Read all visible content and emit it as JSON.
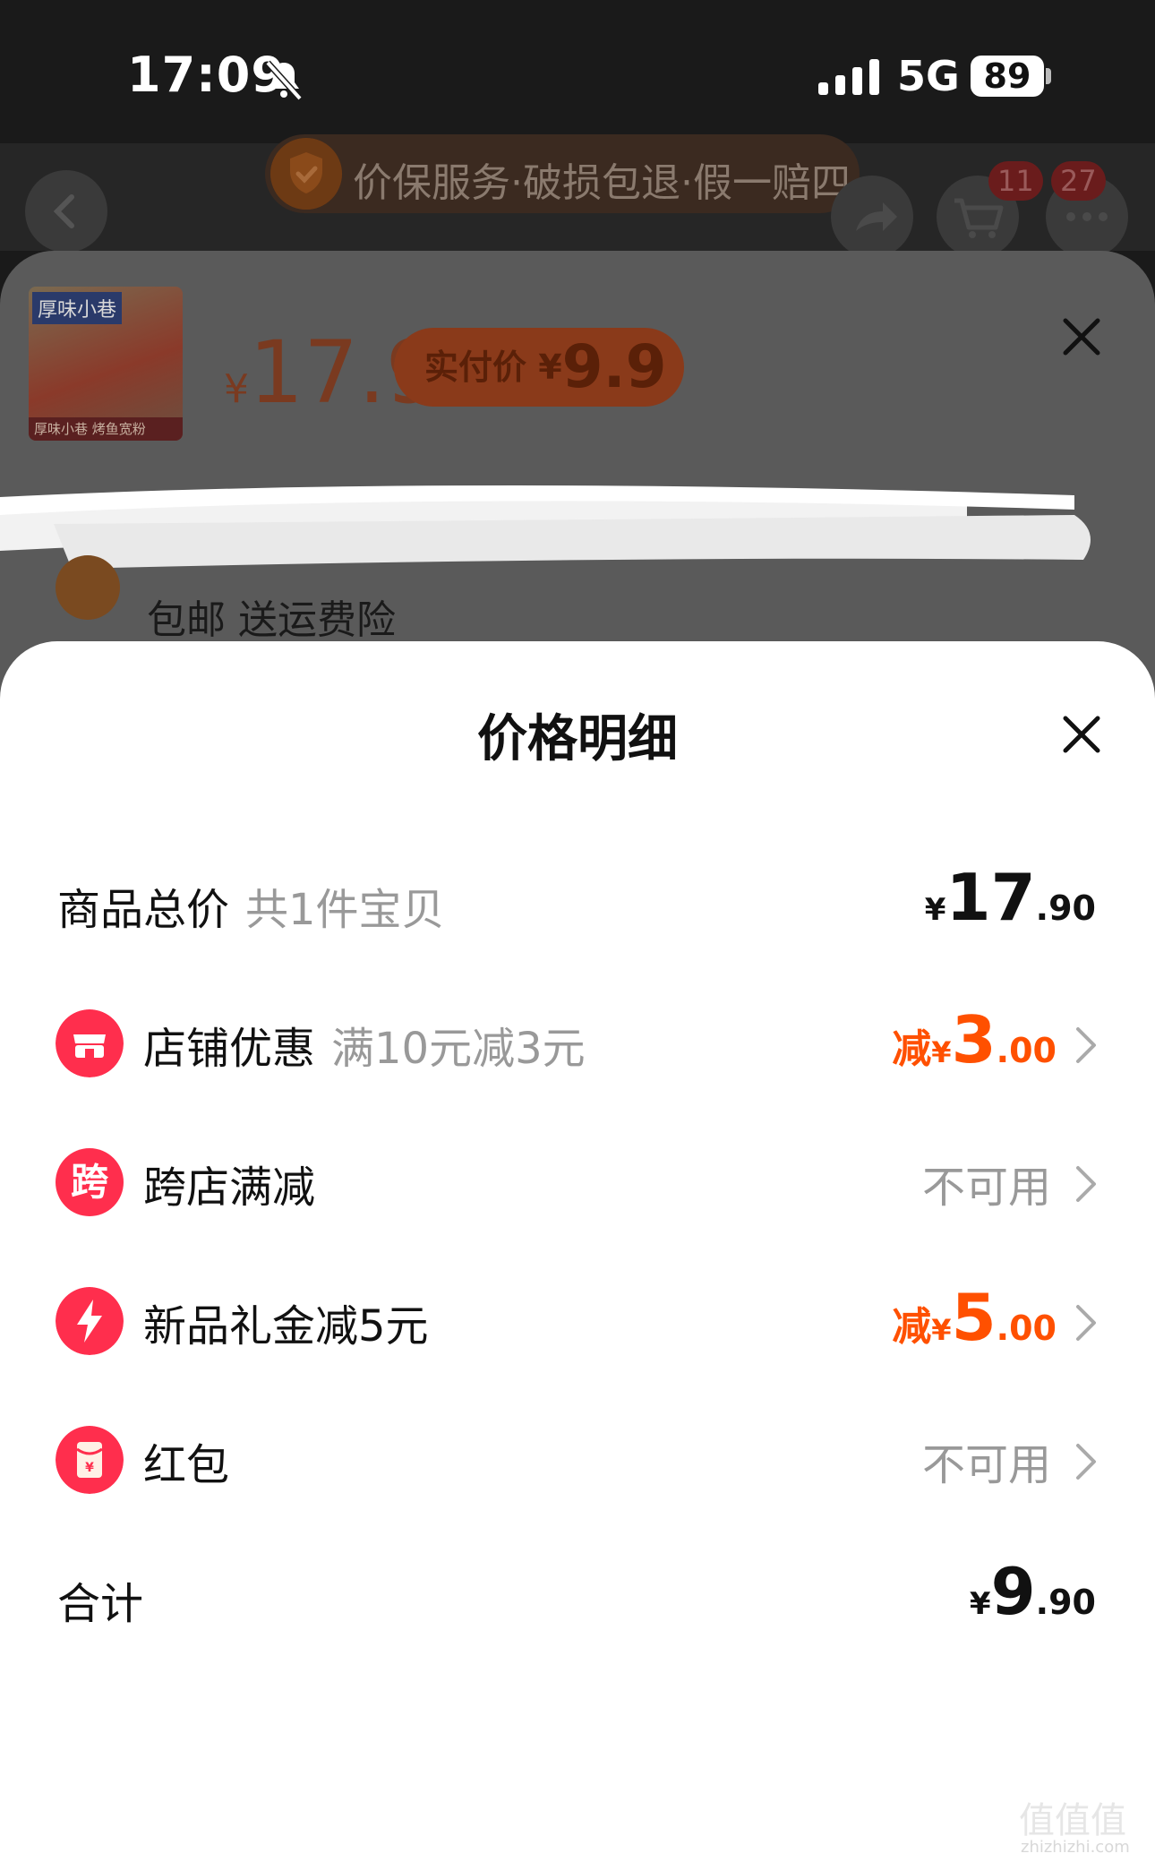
{
  "status_bar": {
    "time": "17:09",
    "network": "5G",
    "battery": "89"
  },
  "header": {
    "guarantee_text": "价保服务·破损包退·假一赔四",
    "cart_badge": "11",
    "more_badge": "27"
  },
  "sku_panel": {
    "currency": "¥",
    "price": "17.9",
    "pay_label": "实付价 ¥",
    "pay_amount": "9.9",
    "thumbnail_label": "厚味小巷",
    "thumbnail_caption": "厚味小巷 烤鱼宽粉",
    "shipping_text": "包邮 送运费险"
  },
  "price_detail": {
    "title": "价格明细",
    "goods_total": {
      "label": "商品总价",
      "sub": "共1件宝贝",
      "currency": "¥",
      "int": "17",
      "dec": ".90"
    },
    "rows": [
      {
        "label": "店铺优惠",
        "sub": "满10元减3元",
        "prefix": "减",
        "currency": "¥",
        "int": "3",
        "dec": ".00",
        "icon": "shop-icon",
        "icon_color": "#ff2e4d"
      },
      {
        "label": "跨店满减",
        "value": "不可用",
        "icon": "kua-icon",
        "icon_text": "跨",
        "icon_color": "#ff2e4d"
      },
      {
        "label": "新品礼金减5元",
        "prefix": "减",
        "currency": "¥",
        "int": "5",
        "dec": ".00",
        "icon": "lightning-icon",
        "icon_color": "#ff2e4d"
      },
      {
        "label": "红包",
        "value": "不可用",
        "icon": "red-packet-icon",
        "icon_color": "#ff2e4d"
      }
    ],
    "total": {
      "label": "合计",
      "currency": "¥",
      "int": "9",
      "dec": ".90"
    }
  },
  "watermark": {
    "text": "值值值",
    "url": "zhizhizhi.com"
  },
  "colors": {
    "accent": "#ff5000",
    "brand_red": "#ff2e4d",
    "muted": "#999999"
  }
}
